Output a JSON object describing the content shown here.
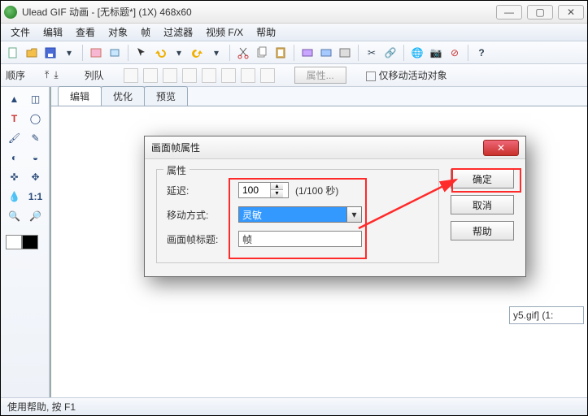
{
  "title": "Ulead GIF 动画 - [无标题*] (1X) 468x60",
  "window_controls": {
    "min": "—",
    "max": "▢",
    "close": "✕"
  },
  "menu": [
    "文件",
    "编辑",
    "查看",
    "对象",
    "帧",
    "过滤器",
    "视频 F/X",
    "帮助"
  ],
  "toolbar2": {
    "seq_label": "顺序",
    "queue_label": "列队",
    "props_button": "属性...",
    "move_only_label": "仅移动活动对象"
  },
  "tabs": {
    "edit": "编辑",
    "optimize": "优化",
    "preview": "预览"
  },
  "side_file": "y5.gif] (1:",
  "statusbar": "使用帮助, 按 F1",
  "dialog": {
    "title": "画面帧属性",
    "group_label": "属性",
    "delay_label": "延迟:",
    "delay_value": "100",
    "delay_unit": "(1/100 秒)",
    "move_label": "移动方式:",
    "move_value": "灵敏",
    "frametitle_label": "画面帧标题:",
    "frametitle_value": "帧",
    "ok": "确定",
    "cancel": "取消",
    "help": "帮助",
    "close_glyph": "✕"
  }
}
